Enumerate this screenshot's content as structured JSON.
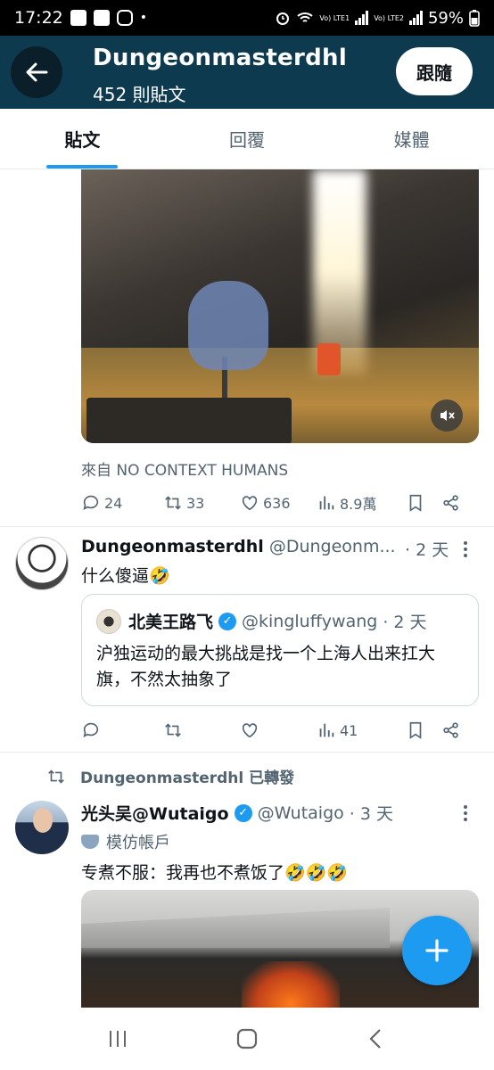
{
  "status_bar": {
    "time": "17:22",
    "dot": "•",
    "lte1": "Vo) LTE1",
    "lte2": "Vo) LTE2",
    "battery": "59%"
  },
  "header": {
    "title": "Dungeonmasterdhl",
    "post_count": "452 則貼文",
    "follow_label": "跟隨"
  },
  "tabs": [
    {
      "label": "貼文"
    },
    {
      "label": "回覆"
    },
    {
      "label": "媒體"
    }
  ],
  "post1": {
    "source": "來自 NO CONTEXT HUMANS",
    "replies": "24",
    "retweets": "33",
    "likes": "636",
    "views": "8.9萬"
  },
  "post2": {
    "name": "Dungeonmasterdhl",
    "handle": "@Dungeonm...",
    "time": "· 2 天",
    "text": "什么傻逼🤣",
    "quote": {
      "name": "北美王路飞",
      "handle": "@kingluffywang",
      "time": "· 2 天",
      "text": "沪独运动的最大挑战是找一个上海人出来扛大旗，不然太抽象了"
    },
    "views": "41"
  },
  "post3": {
    "retweeted_by": "Dungeonmasterdhl 已轉發",
    "name": "光头吴@Wutaigo",
    "handle": "@Wutaigo",
    "time": "· 3 天",
    "label": "模仿帳戶",
    "text": "专煮不服：我再也不煮饭了🤣🤣🤣"
  },
  "colors": {
    "accent": "#1d9bf0",
    "header_bg": "#0e3a50",
    "muted": "#536471"
  }
}
